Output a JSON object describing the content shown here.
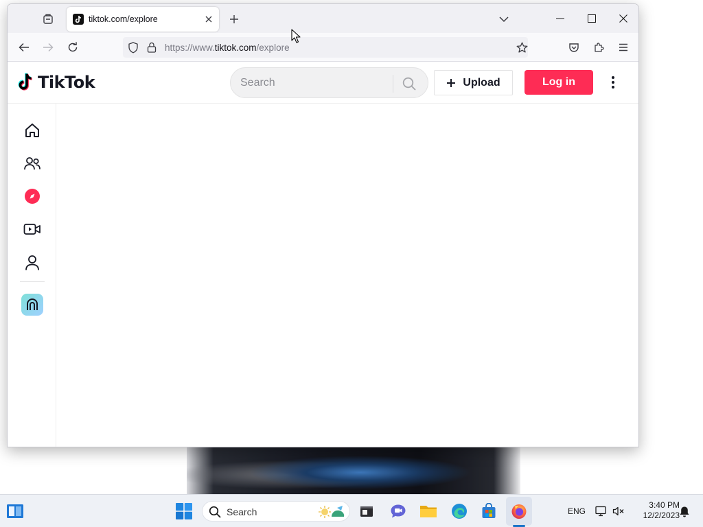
{
  "browser": {
    "tab": {
      "title": "tiktok.com/explore",
      "favicon": "tiktok-favicon-icon"
    },
    "url": {
      "prefix": "https://www.",
      "host": "tiktok.com",
      "path": "/explore"
    },
    "icons": [
      "tab-list-icon",
      "close-icon",
      "plus-icon",
      "chevron-down-icon",
      "minimize-icon",
      "maximize-icon",
      "back-arrow-icon",
      "forward-arrow-icon",
      "reload-icon",
      "shield-icon",
      "lock-icon",
      "star-icon",
      "pocket-icon",
      "extensions-icon",
      "menu-icon"
    ]
  },
  "tiktok": {
    "logo_text": "TikTok",
    "search": {
      "placeholder": "Search"
    },
    "upload_label": "Upload",
    "login_label": "Log in",
    "brand_color": "#fe2c55",
    "sidebar_icons": [
      "home-icon",
      "following-icon",
      "explore-icon",
      "live-icon",
      "profile-icon",
      "live-badge-icon"
    ]
  },
  "taskbar": {
    "search_label": "Search",
    "language": "ENG",
    "time": "3:40 PM",
    "date": "12/2/2023",
    "apps": [
      "file-explorer-icon",
      "teams-chat-icon",
      "folder-icon",
      "edge-icon",
      "store-icon",
      "firefox-icon"
    ]
  }
}
